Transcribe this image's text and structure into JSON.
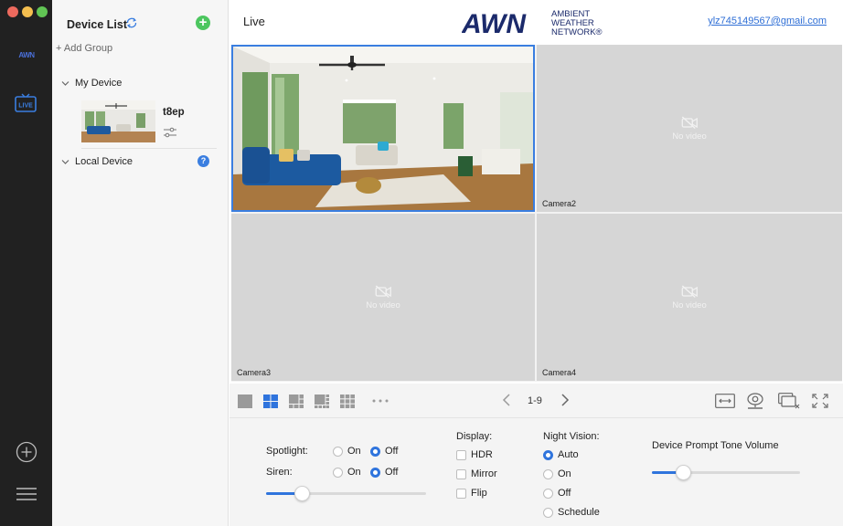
{
  "window": {
    "traffic_lights": [
      "close",
      "minimize",
      "zoom"
    ]
  },
  "rail": {
    "logo": "AWN",
    "live_badge": "LIVE"
  },
  "device_panel": {
    "title": "Device List",
    "add_group": "+ Add Group",
    "groups": [
      {
        "label": "My Device",
        "devices": [
          {
            "name": "t8ep"
          }
        ]
      },
      {
        "label": "Local Device"
      }
    ],
    "help_glyph": "?"
  },
  "header": {
    "title": "Live",
    "brand": {
      "short": "AWN",
      "line1": "AMBIENT",
      "line2": "WEATHER",
      "line3": "NETWORK®"
    },
    "user_email": "ylz745149567@gmail.com"
  },
  "cameras": [
    {
      "label": "",
      "has_video": true
    },
    {
      "label": "Camera2",
      "status": "No video"
    },
    {
      "label": "Camera3",
      "status": "No video"
    },
    {
      "label": "Camera4",
      "status": "No video"
    }
  ],
  "toolbar": {
    "page_range": "1-9"
  },
  "controls": {
    "spotlight": {
      "label": "Spotlight:",
      "on": "On",
      "off": "Off",
      "value": "Off"
    },
    "siren": {
      "label": "Siren:",
      "on": "On",
      "off": "Off",
      "value": "Off",
      "level": 0.22
    },
    "display": {
      "label": "Display:",
      "options": [
        "HDR",
        "Mirror",
        "Flip"
      ]
    },
    "night_vision": {
      "label": "Night Vision:",
      "options": [
        "Auto",
        "On",
        "Off",
        "Schedule"
      ],
      "value": "Auto"
    },
    "prompt_volume": {
      "label": "Device Prompt Tone Volume",
      "level": 0.21
    }
  },
  "colors": {
    "accent": "#2f74dd",
    "add_green": "#4cc65f",
    "rail_bg": "#212121",
    "brand_navy": "#1b2a6b"
  }
}
